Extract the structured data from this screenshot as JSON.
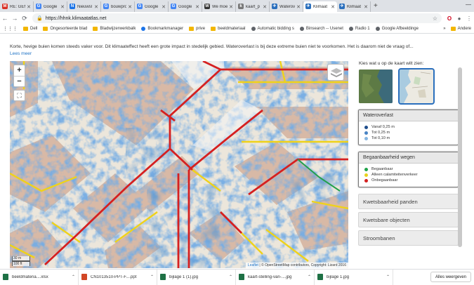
{
  "tabs": [
    {
      "label": "RE: GEM",
      "icon": "gmail-icon",
      "color": "#d93025",
      "fav": "M"
    },
    {
      "label": "Google",
      "icon": "google-icon",
      "color": "#4285f4",
      "fav": "G"
    },
    {
      "label": "Nieuwsl",
      "icon": "news-icon",
      "color": "#1a73e8",
      "fav": "N"
    },
    {
      "label": "bouwpro",
      "icon": "google-icon",
      "color": "#4285f4",
      "fav": "G"
    },
    {
      "label": "Google",
      "icon": "google-icon",
      "color": "#4285f4",
      "fav": "G"
    },
    {
      "label": "Google",
      "icon": "google-icon",
      "color": "#4285f4",
      "fav": "G"
    },
    {
      "label": "We moe",
      "icon": "page-icon",
      "color": "#333333",
      "fav": "W"
    },
    {
      "label": "kaart_p",
      "icon": "doc-icon",
      "color": "#777777",
      "fav": "k"
    },
    {
      "label": "Waterov",
      "icon": "plane-icon",
      "color": "#2a6fbd",
      "fav": "✈"
    },
    {
      "label": "Klimaat",
      "icon": "plane-icon",
      "color": "#2a6fbd",
      "fav": "✈",
      "active": true
    },
    {
      "label": "Klimaat",
      "icon": "plane-icon",
      "color": "#2a6fbd",
      "fav": "✈"
    }
  ],
  "address": {
    "url": "https://hhnk.klimaatatlas.net"
  },
  "bookmarks": [
    {
      "label": "Dell",
      "kind": "folder"
    },
    {
      "label": "Ongesorteerde blad",
      "kind": "folder"
    },
    {
      "label": "Bladwijzerwerkbalk",
      "kind": "folder"
    },
    {
      "label": "Bookmarkmanager",
      "kind": "star"
    },
    {
      "label": "prive",
      "kind": "folder"
    },
    {
      "label": "beeldmateriaal",
      "kind": "folder"
    },
    {
      "label": "Automatic bidding s",
      "kind": "site"
    },
    {
      "label": "Binsearch -- Usenet",
      "kind": "site"
    },
    {
      "label": "Radio 1",
      "kind": "site"
    },
    {
      "label": "Google Afbeeldinge",
      "kind": "site"
    }
  ],
  "bookmarks_more": "»",
  "bookmarks_other": "Andere",
  "page": {
    "intro": "Korte, hevige buien komen steeds vaker voor. Dit klimaateffect heeft een grote impact in stedelijk gebied. Wateroverlast is bij deze extreme buien niet te voorkomen. Het is daarom niet de vraag of...",
    "read_more": "Lees meer"
  },
  "map": {
    "zoom_in": "+",
    "zoom_out": "−",
    "scale_m": "30 m",
    "scale_ft": "100 ft",
    "attribution_leaflet": "Leaflet",
    "attribution_rest": "| © OpenStreetMap contributors, Copyright: Lizard 2016"
  },
  "panel": {
    "heading": "Kies wat u op de kaart wilt zien:",
    "layers": [
      {
        "title": "Wateroverlast",
        "items": [
          {
            "label": "Vanaf 0,25 m",
            "color": "#1f4e8c"
          },
          {
            "label": "Tot 0,25 m",
            "color": "#4a84c4"
          },
          {
            "label": "Tot 0,10 m",
            "color": "#86b5e0"
          }
        ]
      },
      {
        "title": "Begaanbaarheid wegen",
        "items": [
          {
            "label": "Begaanbaar",
            "color": "#1fa34a"
          },
          {
            "label": "Alleen calamiteitenverkeer",
            "color": "#e8d21d"
          },
          {
            "label": "Onbegaanbaar",
            "color": "#d32020"
          }
        ]
      }
    ],
    "sections": [
      "Kwetsbaarheid panden",
      "Kwetsbare objecten",
      "Stroombanen"
    ]
  },
  "downloads": [
    {
      "label": "beeldmateria....xlsx",
      "icon": "excel-icon",
      "color": "#1e7145"
    },
    {
      "label": "CN1013510-PPT-F....ppt",
      "icon": "ppt-icon",
      "color": "#d24726"
    },
    {
      "label": "bijlage 1 (1).jpg",
      "icon": "image-icon",
      "color": "#1e7145"
    },
    {
      "label": "kaart-stelling-van-....jpg",
      "icon": "image-icon",
      "color": "#1e7145"
    },
    {
      "label": "bijlage 1.jpg",
      "icon": "image-icon",
      "color": "#1e7145"
    }
  ],
  "show_all": "Alles weergeven"
}
